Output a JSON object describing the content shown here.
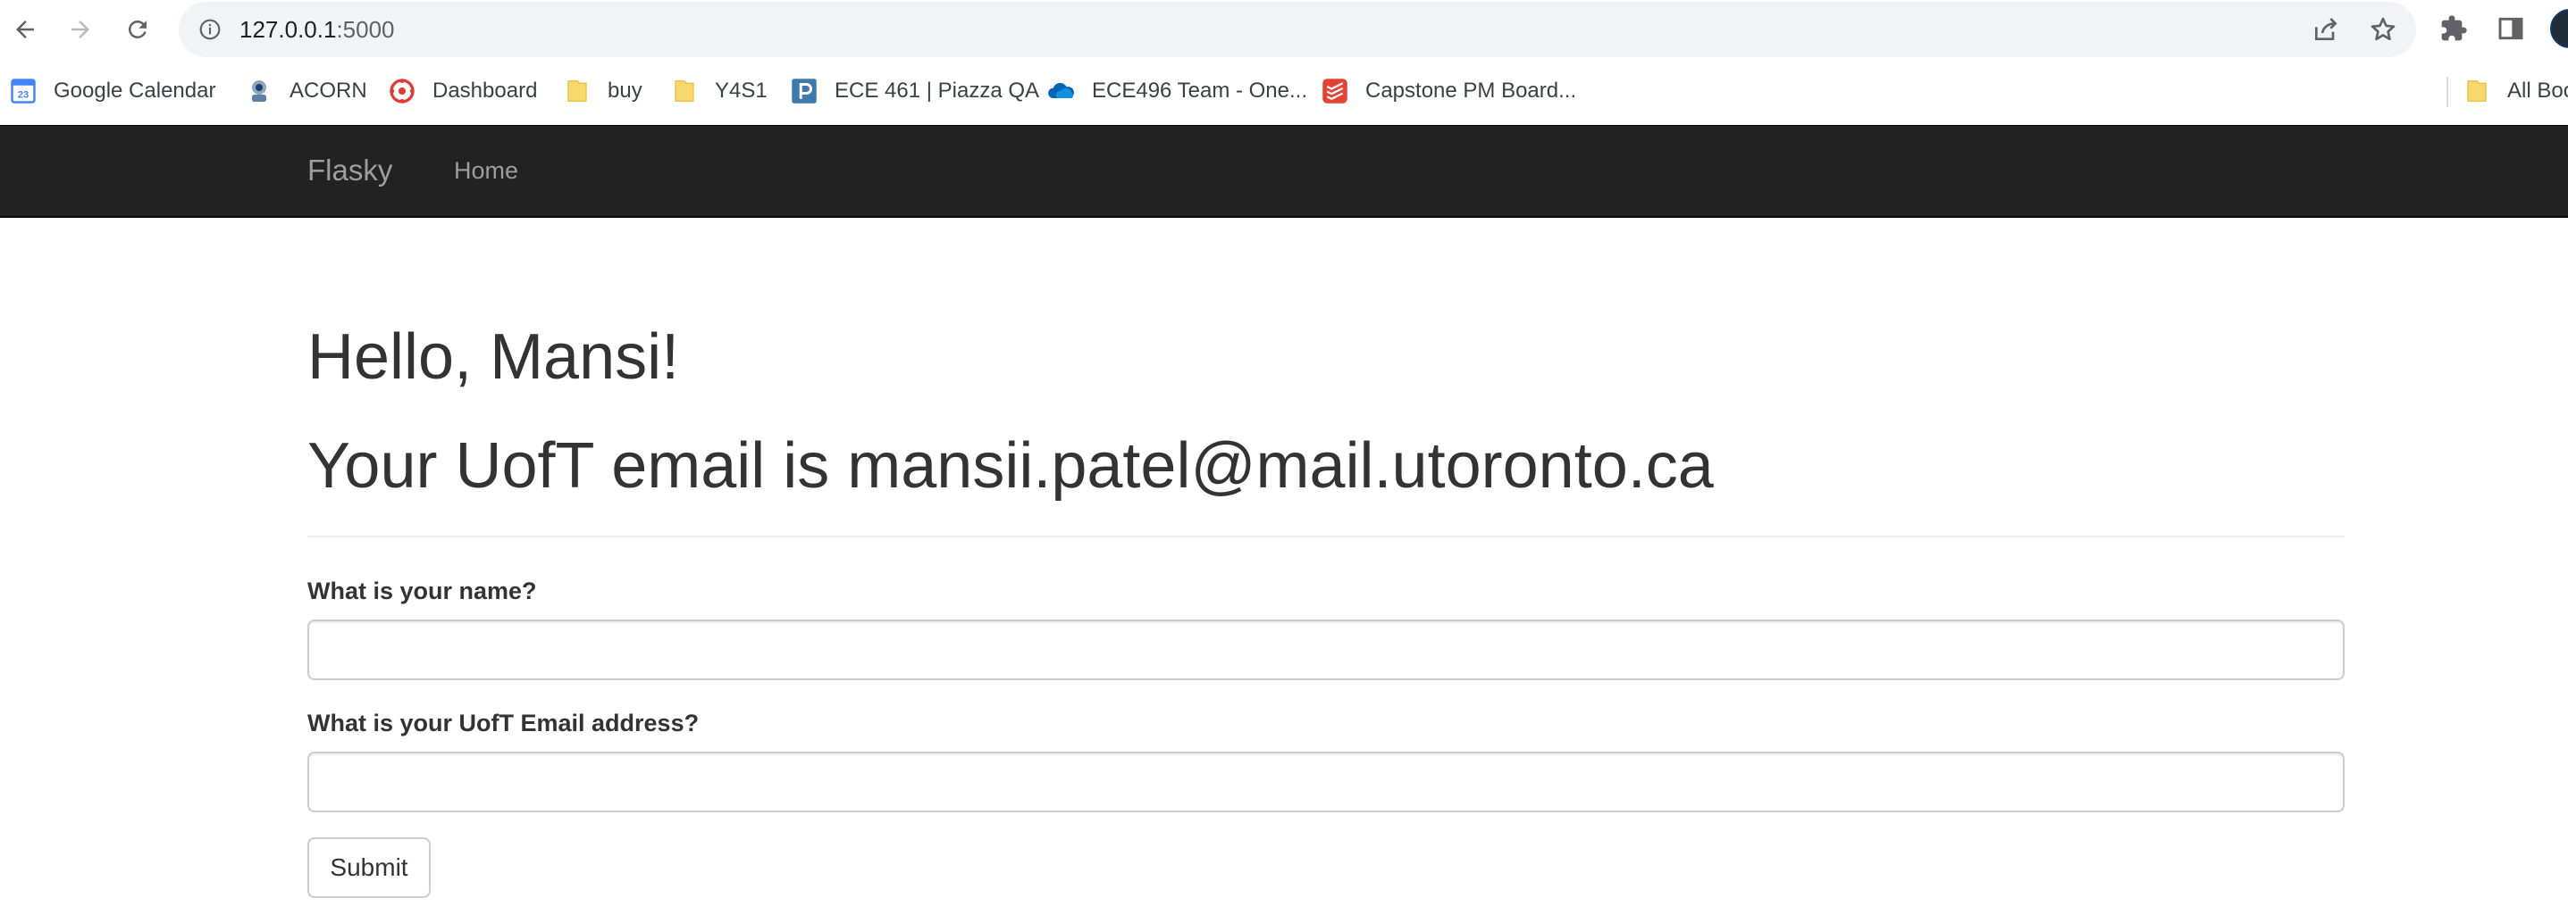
{
  "browser": {
    "url_host": "127.0.0.1",
    "url_port": ":5000",
    "icons": {
      "back": "back-arrow-icon",
      "forward": "forward-arrow-icon",
      "reload": "reload-icon",
      "info": "site-info-icon",
      "share": "share-icon",
      "bookmark": "star-icon",
      "extensions": "puzzle-icon",
      "side_panel": "side-panel-icon"
    }
  },
  "bookmarks": {
    "items": [
      {
        "label": "Google Calendar",
        "icon": "calendar-icon"
      },
      {
        "label": "ACORN",
        "icon": "acorn-icon"
      },
      {
        "label": "Dashboard",
        "icon": "dashboard-icon"
      },
      {
        "label": "buy",
        "icon": "folder-icon"
      },
      {
        "label": "Y4S1",
        "icon": "folder-icon"
      },
      {
        "label": "ECE 461 | Piazza QA",
        "icon": "piazza-icon"
      },
      {
        "label": "ECE496 Team - One...",
        "icon": "onedrive-icon"
      },
      {
        "label": "Capstone PM Board...",
        "icon": "todoist-icon"
      },
      {
        "label": "All Boo",
        "icon": "folder-icon"
      }
    ]
  },
  "navbar": {
    "brand": "Flasky",
    "links": [
      "Home"
    ]
  },
  "page": {
    "greeting": "Hello, Mansi!",
    "email_line": "Your UofT email is mansii.patel@mail.utoronto.ca"
  },
  "form": {
    "name_label": "What is your name?",
    "name_value": "",
    "email_label": "What is your UofT Email address?",
    "email_value": "",
    "submit_label": "Submit"
  },
  "colors": {
    "navbar_bg": "#222222",
    "navbar_text": "#9d9d9d",
    "body_text": "#333333",
    "omnibox_bg": "#f1f3f4"
  }
}
